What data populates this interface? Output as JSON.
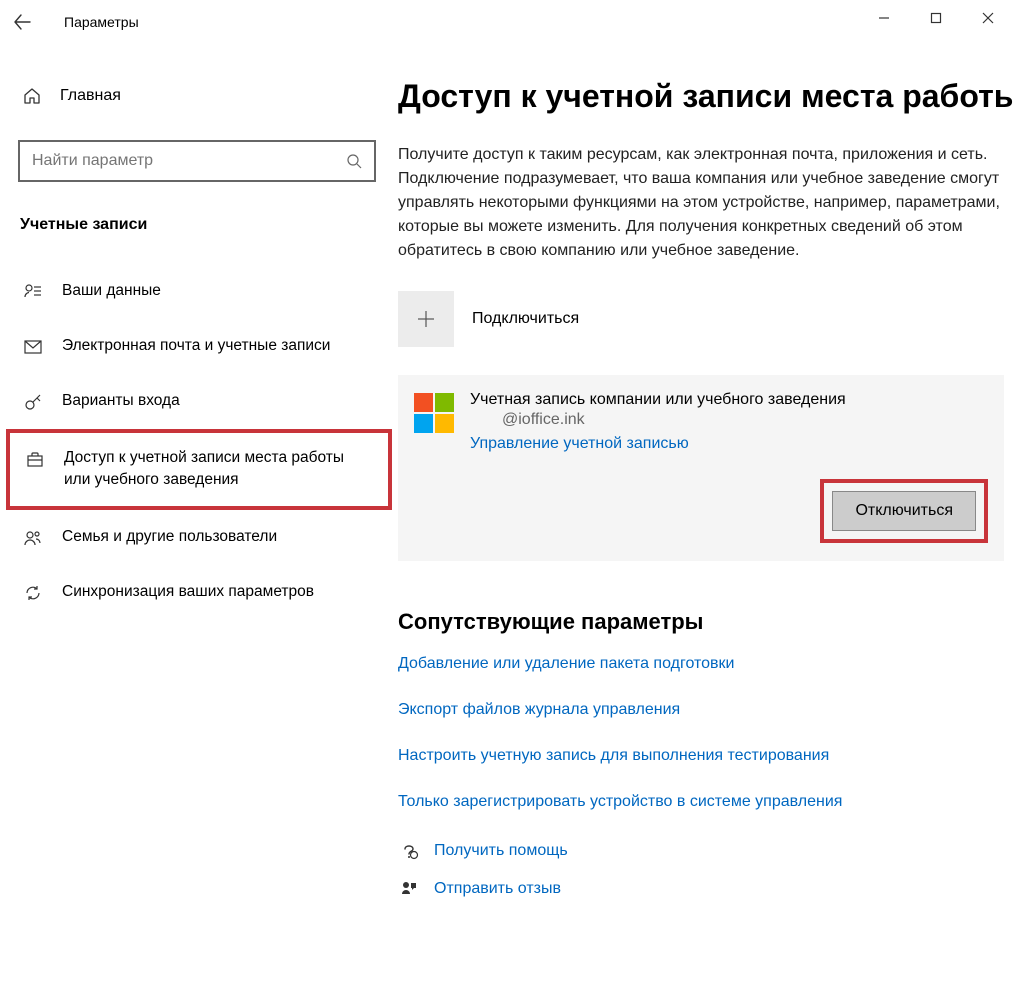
{
  "window": {
    "title": "Параметры"
  },
  "sidebar": {
    "home": "Главная",
    "search_placeholder": "Найти параметр",
    "section": "Учетные записи",
    "items": [
      {
        "label": "Ваши данные"
      },
      {
        "label": "Электронная почта и учетные записи"
      },
      {
        "label": "Варианты входа"
      },
      {
        "label": "Доступ к учетной записи места работы или учебного заведения"
      },
      {
        "label": "Семья и другие пользователи"
      },
      {
        "label": "Синхронизация ваших параметров"
      }
    ]
  },
  "main": {
    "title": "Доступ к учетной записи места работы",
    "description": "Получите доступ к таким ресурсам, как электронная почта, приложения и сеть. Подключение подразумевает, что ваша компания или учебное заведение смогут управлять некоторыми функциями на этом устройстве, например, параметрами, которые вы можете изменить. Для получения конкретных сведений об этом обратитесь в свою компанию или учебное заведение.",
    "connect_label": "Подключиться",
    "account": {
      "name": "Учетная запись компании или учебного заведения",
      "email": "@ioffice.ink",
      "manage": "Управление учетной записью",
      "disconnect": "Отключиться"
    },
    "related": {
      "heading": "Сопутствующие параметры",
      "links": [
        "Добавление или удаление пакета подготовки",
        "Экспорт файлов журнала управления",
        "Настроить учетную запись для выполнения тестирования",
        "Только зарегистрировать устройство в системе управления"
      ]
    },
    "footer": {
      "help": "Получить помощь",
      "feedback": "Отправить отзыв"
    }
  }
}
